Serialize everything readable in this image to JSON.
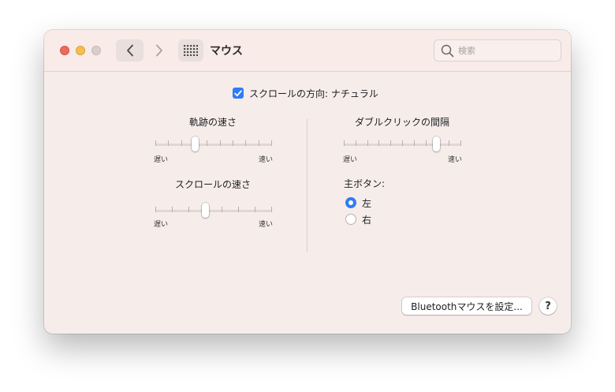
{
  "window": {
    "title": "マウス",
    "search_placeholder": "検索"
  },
  "scroll_direction": {
    "label": "スクロールの方向: ナチュラル",
    "checked": true
  },
  "tracking_speed": {
    "label": "軌跡の速さ",
    "min_label": "遅い",
    "max_label": "速い",
    "value_fraction": 0.34
  },
  "scroll_speed": {
    "label": "スクロールの速さ",
    "min_label": "遅い",
    "max_label": "速い",
    "value_fraction": 0.43
  },
  "double_click": {
    "label": "ダブルクリックの間隔",
    "min_label": "遅い",
    "max_label": "速い",
    "value_fraction": 0.79
  },
  "primary_button": {
    "label": "主ボタン:",
    "options": [
      {
        "label": "左",
        "selected": true
      },
      {
        "label": "右",
        "selected": false
      }
    ]
  },
  "footer": {
    "bluetooth_button": "Bluetoothマウスを設定...",
    "help_button": "?"
  },
  "colors": {
    "accent": "#2f7cf6",
    "close": "#ed6a5e",
    "minimize": "#f5bf4f",
    "zoom_inactive": "#d7cfcd"
  }
}
